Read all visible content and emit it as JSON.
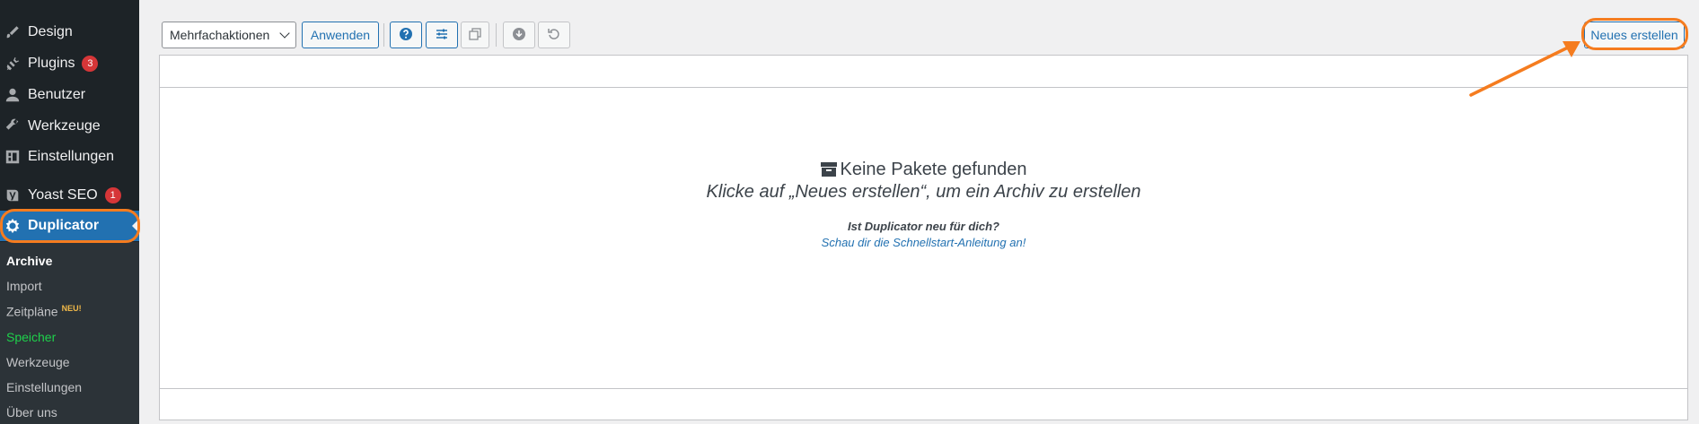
{
  "sidebar": {
    "items": [
      {
        "label": "Design",
        "icon": "brush-icon"
      },
      {
        "label": "Plugins",
        "icon": "plug-icon",
        "badge": "3"
      },
      {
        "label": "Benutzer",
        "icon": "user-icon"
      },
      {
        "label": "Werkzeuge",
        "icon": "wrench-icon"
      },
      {
        "label": "Einstellungen",
        "icon": "settings-icon"
      },
      {
        "label": "Yoast SEO",
        "icon": "yoast-icon",
        "badge": "1"
      },
      {
        "label": "Duplicator",
        "icon": "duplicator-icon"
      }
    ],
    "submenu": [
      {
        "label": "Archive"
      },
      {
        "label": "Import"
      },
      {
        "label": "Zeitpläne",
        "badge": "NEU!"
      },
      {
        "label": "Speicher"
      },
      {
        "label": "Werkzeuge"
      },
      {
        "label": "Einstellungen"
      },
      {
        "label": "Über uns"
      }
    ]
  },
  "toolbar": {
    "bulk_actions": "Mehrfachaktionen",
    "apply": "Anwenden",
    "new_button": "Neues erstellen"
  },
  "empty_state": {
    "title": "Keine Pakete gefunden",
    "subtitle": "Klicke auf „Neues erstellen“, um ein Archiv zu erstellen",
    "new_question": "Ist Duplicator neu für dich?",
    "quickstart_link": "Schau dir die Schnellstart-Anleitung an!"
  },
  "colors": {
    "accent": "#2271b1",
    "sidebar_bg": "#1d2327",
    "highlight": "#f57c1f",
    "badge": "#d63638"
  }
}
